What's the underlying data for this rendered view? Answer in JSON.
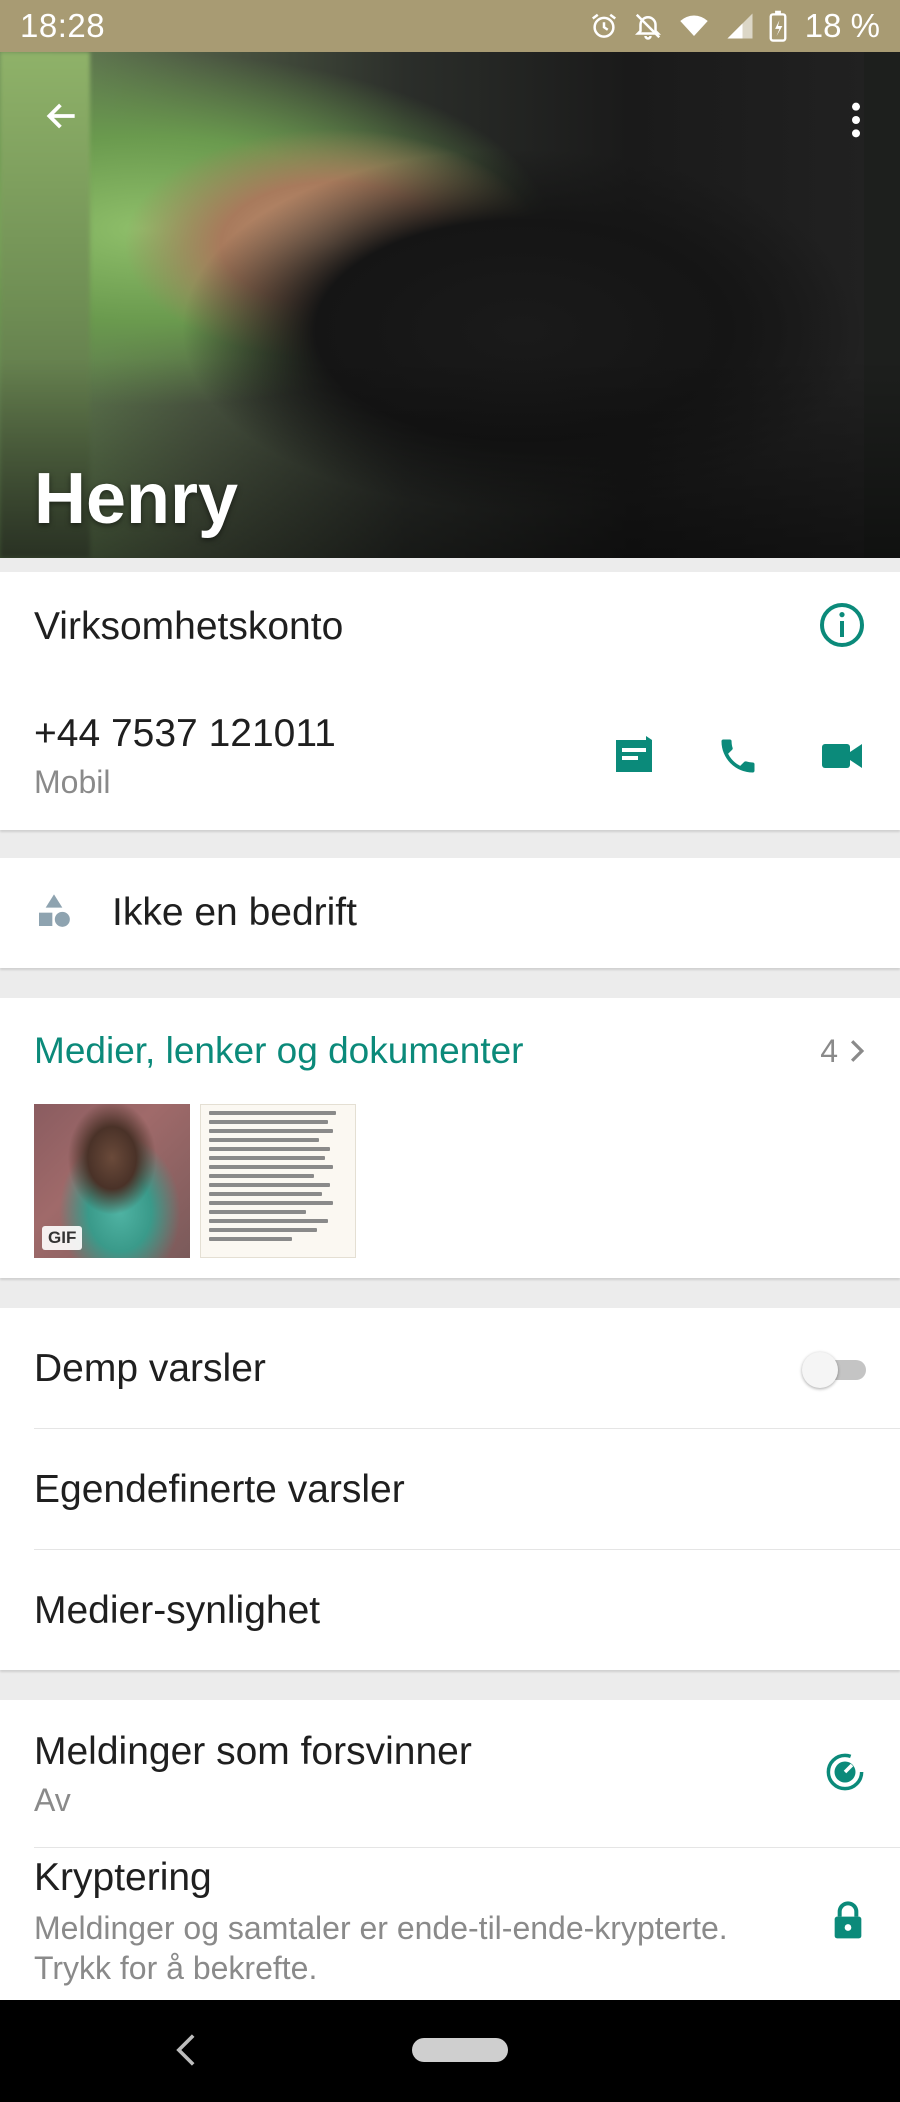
{
  "status_bar": {
    "time": "18:28",
    "battery": "18 %",
    "icons": [
      "alarm-icon",
      "notifications-off-icon",
      "wifi-icon",
      "signal-icon",
      "battery-charging-icon"
    ]
  },
  "header": {
    "name": "Henry",
    "icons": [
      "back-arrow-icon",
      "more-vert-icon"
    ]
  },
  "account": {
    "business_label": "Virksomhetskonto",
    "phone": "+44 7537 121011",
    "phone_type": "Mobil",
    "actions": [
      "message-icon",
      "call-icon",
      "video-call-icon"
    ]
  },
  "business": {
    "label": "Ikke en bedrift",
    "icon": "category-icon"
  },
  "media": {
    "title": "Medier, lenker og dokumenter",
    "count": "4",
    "gif_badge": "GIF"
  },
  "settings": {
    "mute": "Demp varsler",
    "custom": "Egendefinerte varsler",
    "visibility": "Medier-synlighet"
  },
  "security": {
    "disappearing_title": "Meldinger som forsvinner",
    "disappearing_value": "Av",
    "encryption_title": "Kryptering",
    "encryption_desc": "Meldinger og samtaler er ende-til-ende-krypterte. Trykk for å bekrefte."
  },
  "colors": {
    "accent": "#0b8a7a",
    "status_bar": "#a89b73"
  }
}
